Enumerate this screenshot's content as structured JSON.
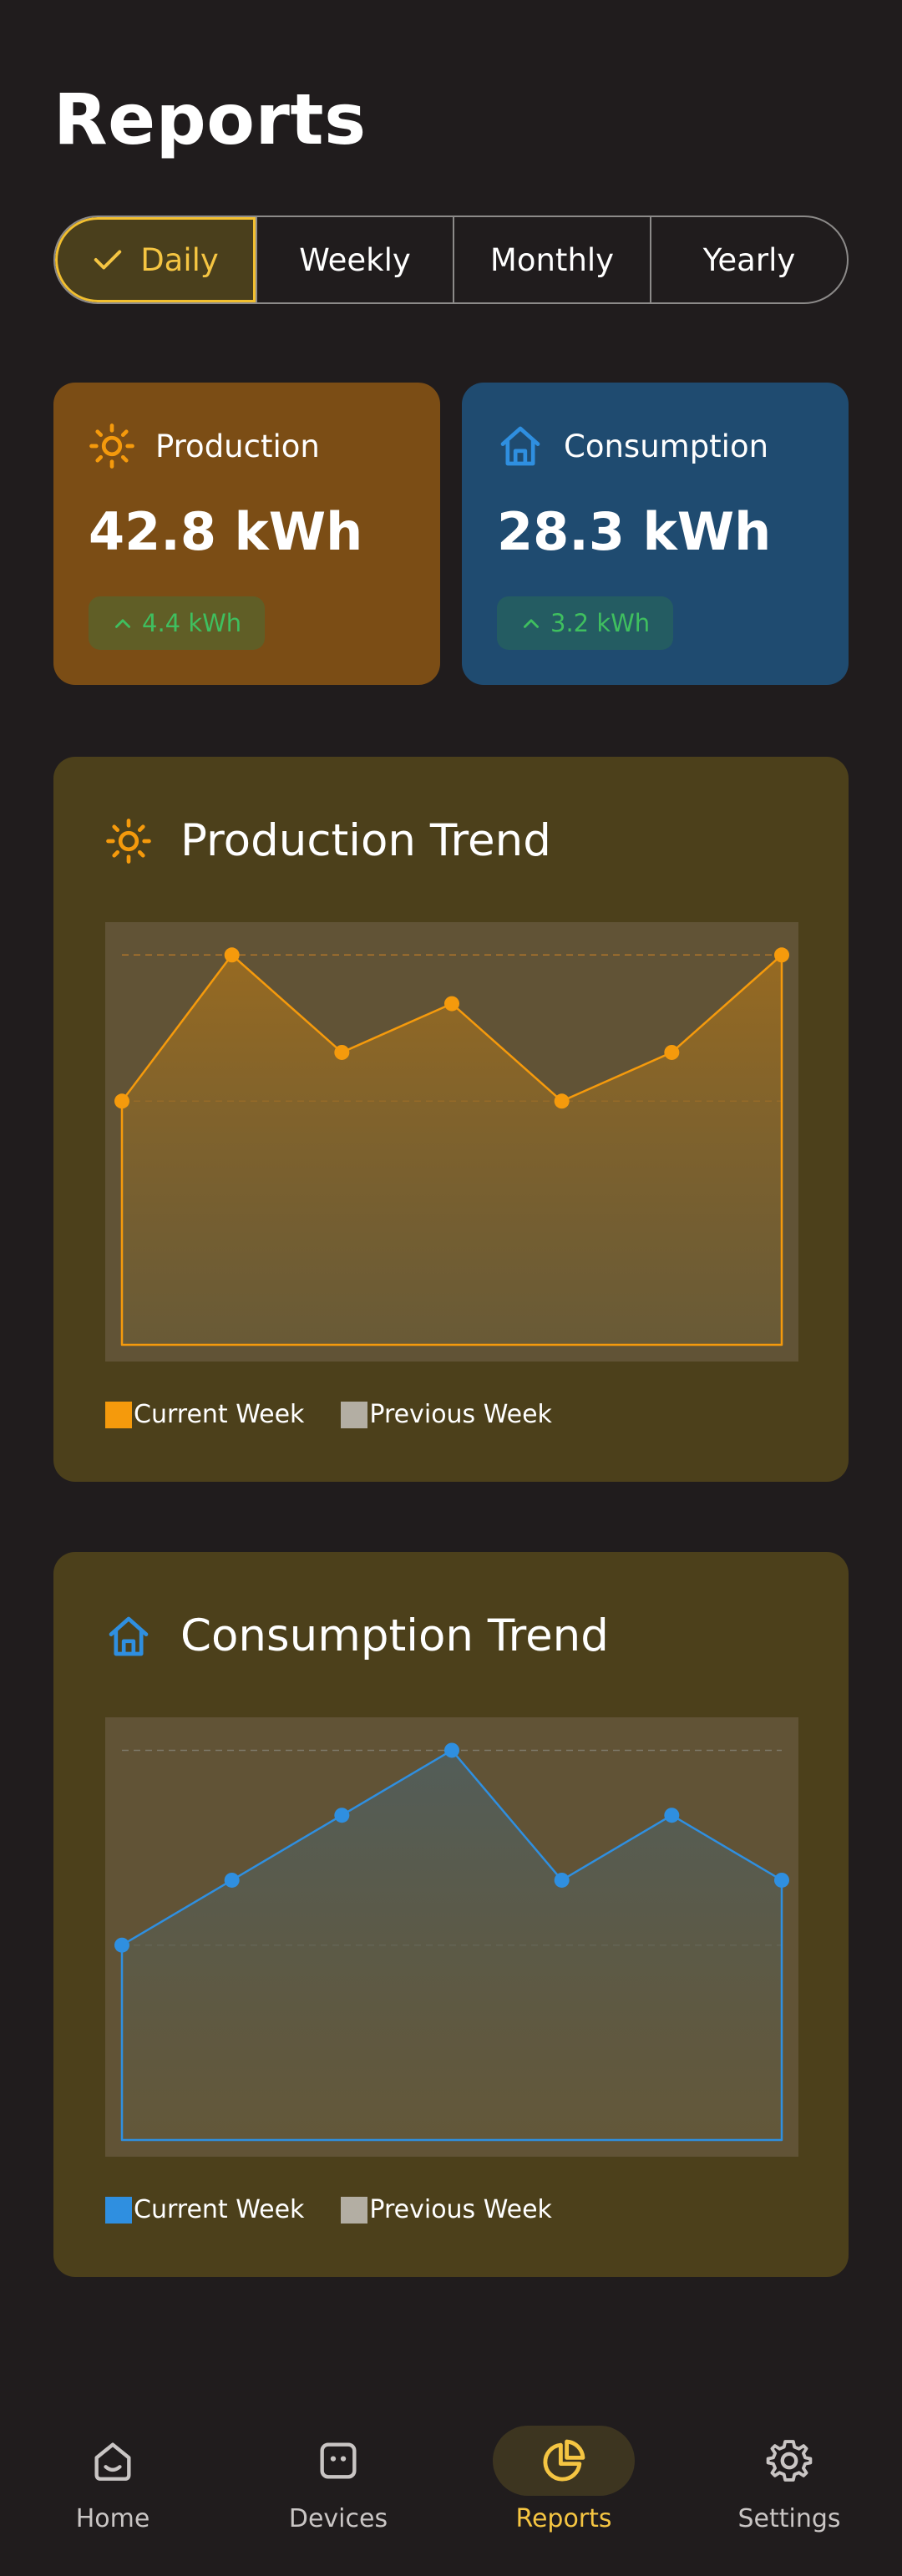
{
  "header": {
    "title": "Reports"
  },
  "periods": [
    {
      "label": "Daily",
      "selected": true
    },
    {
      "label": "Weekly",
      "selected": false
    },
    {
      "label": "Monthly",
      "selected": false
    },
    {
      "label": "Yearly",
      "selected": false
    }
  ],
  "summary": {
    "production": {
      "label": "Production",
      "value": "42.8 kWh",
      "delta": "4.4 kWh",
      "icon": "sun-icon",
      "color": "#7b4d15"
    },
    "consumption": {
      "label": "Consumption",
      "value": "28.3 kWh",
      "delta": "3.2 kWh",
      "icon": "home-icon",
      "color": "#1f4b70"
    }
  },
  "trends": {
    "production": {
      "title": "Production Trend",
      "legend": [
        "Current Week",
        "Previous Week"
      ],
      "accent": "#f59a0c"
    },
    "consumption": {
      "title": "Consumption Trend",
      "legend": [
        "Current Week",
        "Previous Week"
      ],
      "accent": "#2f8fe0"
    }
  },
  "chart_data": [
    {
      "type": "area",
      "title": "Production Trend",
      "x": [
        1,
        2,
        3,
        4,
        5,
        6,
        7
      ],
      "series": [
        {
          "name": "Current Week",
          "values": [
            5,
            8,
            6,
            7,
            5,
            6,
            8
          ]
        },
        {
          "name": "Previous Week",
          "values": []
        }
      ],
      "ylim": [
        0,
        8.33
      ],
      "grid": true,
      "legend": "bottom-left"
    },
    {
      "type": "area",
      "title": "Consumption Trend",
      "x": [
        1,
        2,
        3,
        4,
        5,
        6,
        7
      ],
      "series": [
        {
          "name": "Current Week",
          "values": [
            3,
            4,
            5,
            6,
            4,
            5,
            4
          ]
        },
        {
          "name": "Previous Week",
          "values": []
        }
      ],
      "ylim": [
        0,
        6.25
      ],
      "grid": true,
      "legend": "bottom-left"
    }
  ],
  "nav": [
    {
      "label": "Home",
      "icon": "home-icon",
      "active": false
    },
    {
      "label": "Devices",
      "icon": "device-icon",
      "active": false
    },
    {
      "label": "Reports",
      "icon": "pie-chart-icon",
      "active": true
    },
    {
      "label": "Settings",
      "icon": "gear-icon",
      "active": false
    }
  ],
  "colors": {
    "background": "#201c1d",
    "accent": "#f5c542",
    "production": "#f59a0c",
    "consumption": "#2f8fe0",
    "legend_previous": "#b3aea3",
    "positive": "#3fbf5f"
  }
}
